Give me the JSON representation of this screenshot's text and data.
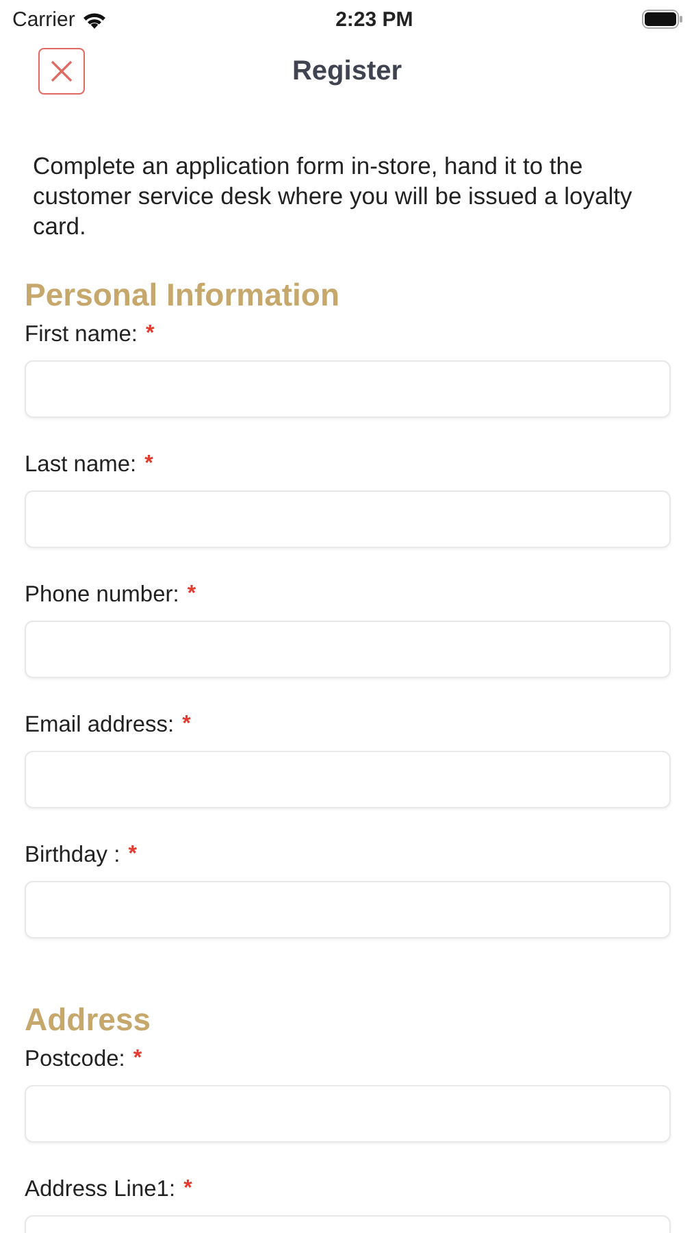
{
  "status_bar": {
    "carrier": "Carrier",
    "time": "2:23 PM"
  },
  "nav": {
    "title": "Register"
  },
  "intro": "Complete an application form in-store, hand it to the customer service desk where you will be issued a loyalty card.",
  "sections": [
    {
      "title": "Personal Information",
      "fields": [
        {
          "label": "First name:",
          "required_mark": "*"
        },
        {
          "label": "Last name:",
          "required_mark": "*"
        },
        {
          "label": "Phone number:",
          "required_mark": "*"
        },
        {
          "label": "Email address:",
          "required_mark": "*"
        },
        {
          "label": "Birthday :",
          "required_mark": "*"
        }
      ]
    },
    {
      "title": "Address",
      "fields": [
        {
          "label": "Postcode:",
          "required_mark": "*"
        },
        {
          "label": "Address Line1:",
          "required_mark": "*"
        }
      ]
    }
  ]
}
